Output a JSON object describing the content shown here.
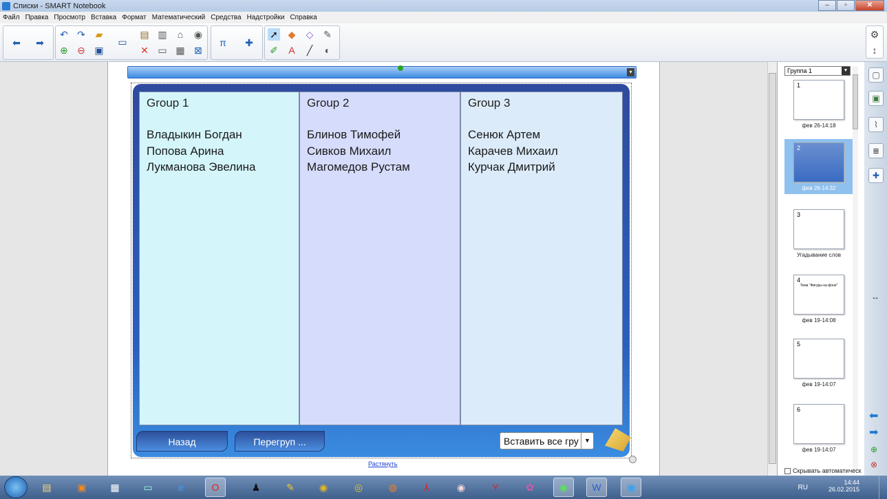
{
  "window": {
    "title": "Списки - SMART Notebook"
  },
  "menu": [
    "Файл",
    "Правка",
    "Просмотр",
    "Вставка",
    "Формат",
    "Математический",
    "Средства",
    "Надстройки",
    "Справка"
  ],
  "widget": {
    "groups": [
      {
        "title": "Group 1",
        "members": [
          "Владыкин Богдан",
          "Попова Арина",
          "Лукманова Эвелина"
        ]
      },
      {
        "title": "Group 2",
        "members": [
          "Блинов Тимофей",
          "Сивков Михаил",
          "Магомедов Рустам"
        ]
      },
      {
        "title": "Group 3",
        "members": [
          "Сенюк Артем",
          "Карачев Михаил",
          "Курчак Дмитрий"
        ]
      }
    ],
    "back_label": "Назад",
    "regroup_label": "Перегруп ...",
    "insert_label": "Вставить все гру",
    "stretch_link": "Растянуть"
  },
  "side_panel": {
    "group_select": "Группа 1",
    "pages": [
      {
        "number": "1",
        "label": "фев 26-14:18"
      },
      {
        "number": "2",
        "label": "фев 26-14:32",
        "active": true
      },
      {
        "number": "3",
        "label": "Угадывание слов"
      },
      {
        "number": "4",
        "label": "фев 19-14:08",
        "thumb_text": "Тема \"Фигуры на фоне\""
      },
      {
        "number": "5",
        "label": "фев 19-14:07"
      },
      {
        "number": "6",
        "label": "фев 19-14:07"
      }
    ],
    "autohide_label": "Скрывать автоматическ"
  },
  "taskbar": {
    "lang": "RU",
    "time": "14:44",
    "date": "26.02.2015"
  },
  "colors": {
    "col1": "#d4f6fb",
    "col2": "#d6dcfb",
    "col3": "#dcebf9",
    "widget_bg": "#2a5fbf"
  }
}
